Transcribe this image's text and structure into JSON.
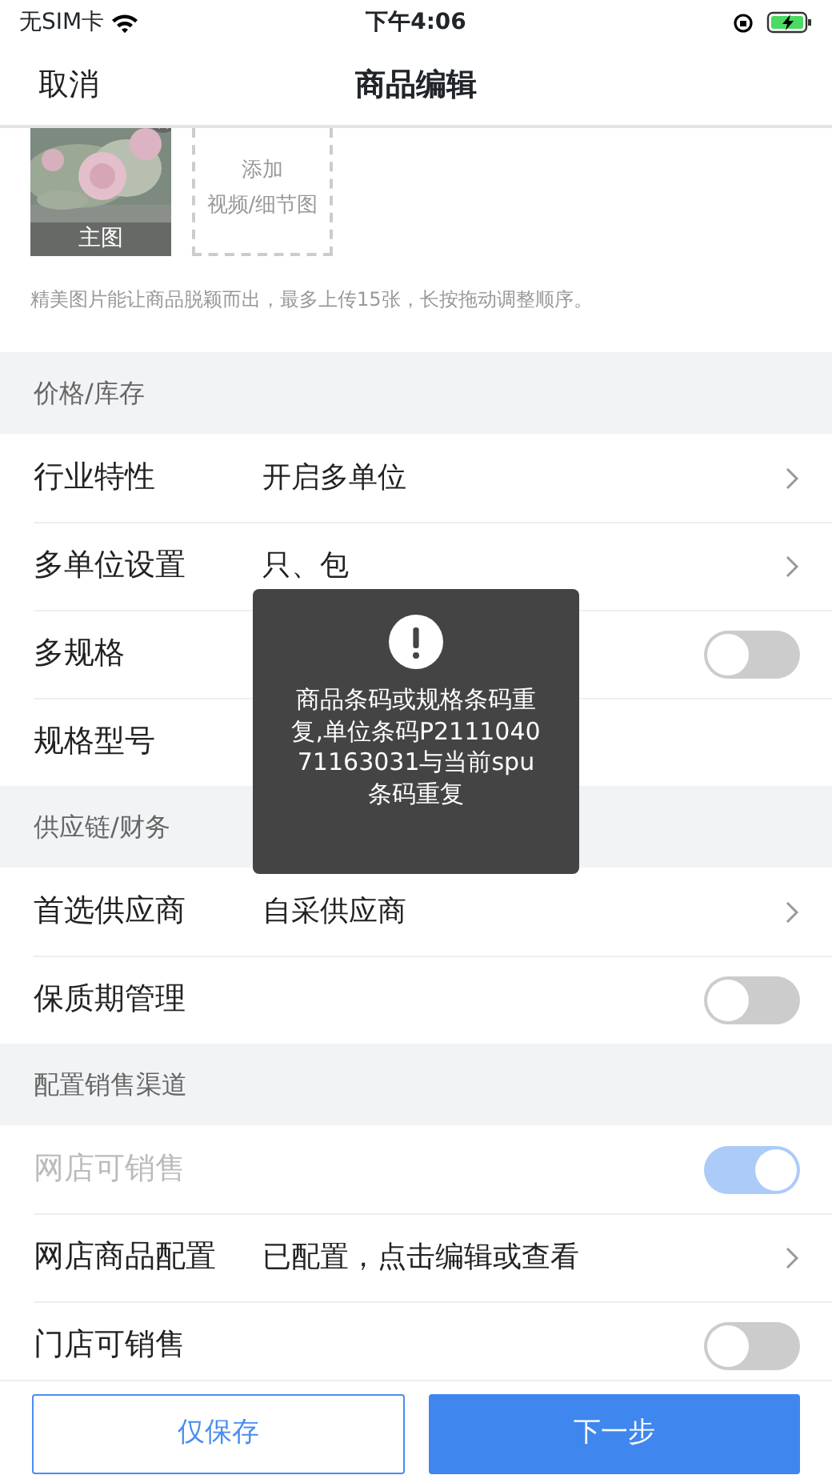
{
  "status_bar": {
    "carrier": "无SIM卡",
    "time": "下午4:06"
  },
  "nav": {
    "cancel": "取消",
    "title": "商品编辑"
  },
  "photos": {
    "main_label": "主图",
    "add_label": "添加",
    "add_sublabel": "视频/细节图",
    "hint": "精美图片能让商品脱颖而出，最多上传15张，长按拖动调整顺序。"
  },
  "sections": [
    {
      "title": "价格/库存",
      "rows": [
        {
          "kind": "nav",
          "label": "行业特性",
          "value": "开启多单位",
          "disabled": false
        },
        {
          "kind": "nav",
          "label": "多单位设置",
          "value": "只、包",
          "disabled": false
        },
        {
          "kind": "toggle",
          "label": "多规格",
          "on": false,
          "disabled": false
        },
        {
          "kind": "text",
          "label": "规格型号",
          "disabled": false
        }
      ]
    },
    {
      "title": "供应链/财务",
      "rows": [
        {
          "kind": "nav",
          "label": "首选供应商",
          "value": "自采供应商",
          "disabled": false
        },
        {
          "kind": "toggle",
          "label": "保质期管理",
          "on": false,
          "disabled": false
        }
      ]
    },
    {
      "title": "配置销售渠道",
      "rows": [
        {
          "kind": "toggle",
          "label": "网店可销售",
          "on": true,
          "disabled": true
        },
        {
          "kind": "nav",
          "label": "网店商品配置",
          "value": "已配置，点击编辑或查看",
          "disabled": false
        },
        {
          "kind": "toggle",
          "label": "门店可销售",
          "on": false,
          "disabled": false
        }
      ]
    }
  ],
  "toast": {
    "message": "商品条码或规格条码重复,单位条码P211104071163031与当前spu条码重复"
  },
  "buttons": [
    {
      "kind": "outline",
      "label": "仅保存"
    },
    {
      "kind": "primary",
      "label": "下一步"
    }
  ]
}
